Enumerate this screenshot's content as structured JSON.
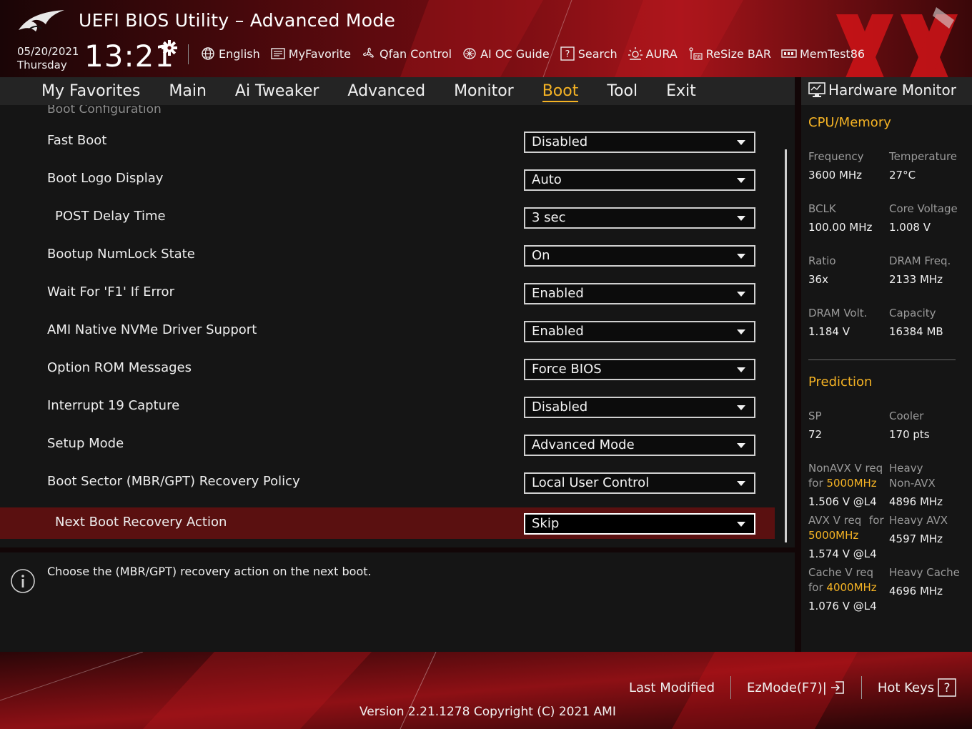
{
  "header": {
    "title": "UEFI BIOS Utility – Advanced Mode",
    "date": "05/20/2021",
    "weekday": "Thursday",
    "time": "13:21",
    "toolbar": [
      {
        "label": "English",
        "icon": "globe-icon"
      },
      {
        "label": "MyFavorite",
        "icon": "favorite-icon"
      },
      {
        "label": "Qfan Control",
        "icon": "fan-icon"
      },
      {
        "label": "AI OC Guide",
        "icon": "ai-chip-icon"
      },
      {
        "label": "Search",
        "icon": "search-icon"
      },
      {
        "label": "AURA",
        "icon": "aura-icon"
      },
      {
        "label": "ReSize BAR",
        "icon": "resize-bar-icon"
      },
      {
        "label": "MemTest86",
        "icon": "memtest-icon"
      }
    ]
  },
  "menu": {
    "items": [
      "My Favorites",
      "Main",
      "Ai Tweaker",
      "Advanced",
      "Monitor",
      "Boot",
      "Tool",
      "Exit"
    ],
    "active": "Boot"
  },
  "main": {
    "section_title": "Boot Configuration",
    "settings": [
      {
        "label": "Fast Boot",
        "value": "Disabled"
      },
      {
        "label": "Boot Logo Display",
        "value": "Auto"
      },
      {
        "label": "POST Delay Time",
        "value": "3 sec"
      },
      {
        "label": "Bootup NumLock State",
        "value": "On"
      },
      {
        "label": "Wait For 'F1' If Error",
        "value": "Enabled"
      },
      {
        "label": "AMI Native NVMe Driver Support",
        "value": "Enabled"
      },
      {
        "label": "Option ROM Messages",
        "value": "Force BIOS"
      },
      {
        "label": "Interrupt 19 Capture",
        "value": "Disabled"
      },
      {
        "label": "Setup Mode",
        "value": "Advanced Mode"
      },
      {
        "label": "Boot Sector (MBR/GPT) Recovery Policy",
        "value": "Local User Control"
      },
      {
        "label": "Next Boot Recovery Action",
        "value": "Skip"
      }
    ],
    "selected_index": 10,
    "help_text": "Choose the (MBR/GPT) recovery action on the next boot."
  },
  "hardware_monitor": {
    "title": "Hardware Monitor",
    "cpu_memory": {
      "heading": "CPU/Memory",
      "frequency_label": "Frequency",
      "frequency": "3600 MHz",
      "temperature_label": "Temperature",
      "temperature": "27°C",
      "bclk_label": "BCLK",
      "bclk": "100.00 MHz",
      "core_voltage_label": "Core Voltage",
      "core_voltage": "1.008 V",
      "ratio_label": "Ratio",
      "ratio": "36x",
      "dram_freq_label": "DRAM Freq.",
      "dram_freq": "2133 MHz",
      "dram_volt_label": "DRAM Volt.",
      "dram_volt": "1.184 V",
      "capacity_label": "Capacity",
      "capacity": "16384 MB"
    },
    "prediction": {
      "heading": "Prediction",
      "sp_label": "SP",
      "sp": "72",
      "cooler_label": "Cooler",
      "cooler": "170 pts",
      "nonavx_label": "NonAVX V req",
      "nonavx_for": "for",
      "nonavx_freq": "5000MHz",
      "nonavx_value": "1.506 V @L4",
      "heavy_nonavx_label1": "Heavy",
      "heavy_nonavx_label2": "Non-AVX",
      "heavy_nonavx_value": "4896 MHz",
      "avx_label": "AVX V req",
      "avx_for": "for",
      "avx_freq": "5000MHz",
      "avx_value": "1.574 V @L4",
      "heavy_avx_label": "Heavy AVX",
      "heavy_avx_value": "4597 MHz",
      "cache_label": "Cache V req",
      "cache_for": "for",
      "cache_freq": "4000MHz",
      "cache_value": "1.076 V @L4",
      "heavy_cache_label": "Heavy Cache",
      "heavy_cache_value": "4696 MHz"
    }
  },
  "footer": {
    "last_modified": "Last Modified",
    "ezmode": "EzMode(F7)|",
    "hot_keys": "Hot Keys",
    "hot_keys_glyph": "?",
    "version": "Version 2.21.1278 Copyright (C) 2021 AMI"
  },
  "colors": {
    "accent": "#f5b324",
    "selected_row": "#5a1010",
    "panel": "#151515",
    "bar": "#242424"
  }
}
